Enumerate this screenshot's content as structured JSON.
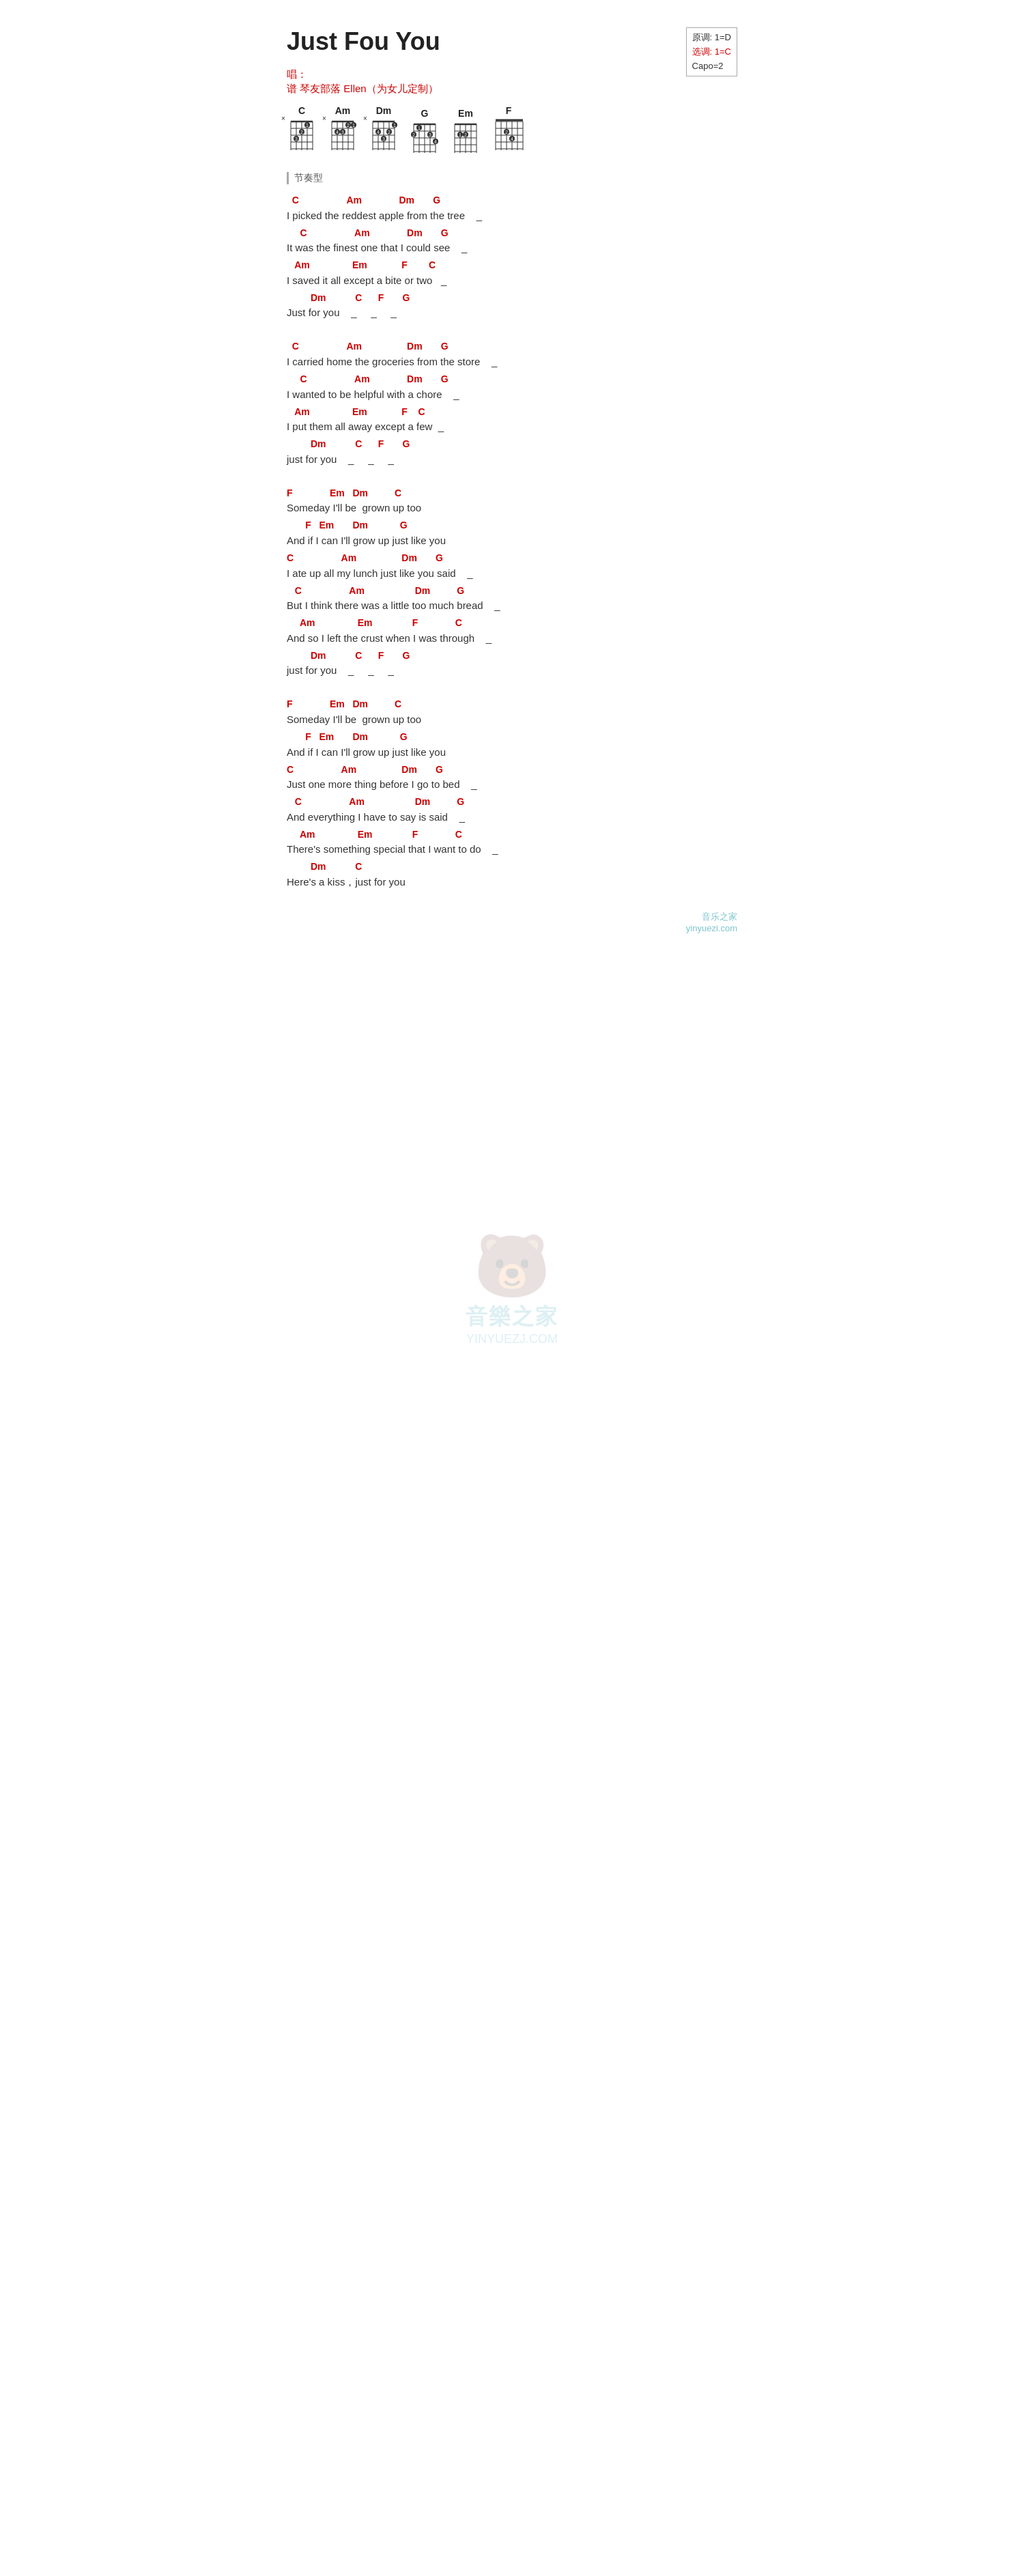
{
  "title": "Just Fou You",
  "singer_label": "唱：",
  "transcriber_label": "谱",
  "transcriber_name": "琴友部落 Ellen（为女儿定制）",
  "key_info": {
    "original": "原调: 1=D",
    "selected": "选调: 1=C",
    "capo": "Capo=2"
  },
  "chord_diagrams": [
    {
      "name": "C"
    },
    {
      "name": "Am"
    },
    {
      "name": "Dm"
    },
    {
      "name": "G"
    },
    {
      "name": "Em"
    },
    {
      "name": "F"
    }
  ],
  "section_label": "节奏型",
  "verses": [
    {
      "lines": [
        {
          "chord": "C                  Am              Dm       G",
          "lyric": "I picked the reddest apple from the tree    _"
        },
        {
          "chord": "   C                  Am              Dm       G",
          "lyric": "It was the finest one that I could see    _"
        },
        {
          "chord": "  Am                Em             F        C",
          "lyric": "I saved it all except a bite or two   _"
        },
        {
          "chord": "       Dm           C      F       G",
          "lyric": "Just for you    _     _     _"
        }
      ]
    },
    {
      "lines": [
        {
          "chord": "C                  Am                 Dm       G",
          "lyric": "I carried home the groceries from the store    _"
        },
        {
          "chord": "   C                  Am              Dm       G",
          "lyric": "I wanted to be helpful with a chore    _"
        },
        {
          "chord": "  Am                Em             F    C",
          "lyric": "I put them all away except a few  _"
        },
        {
          "chord": "       Dm           C      F       G",
          "lyric": "just for you    _     _     _"
        }
      ]
    },
    {
      "lines": [
        {
          "chord": "F              Em   Dm          C",
          "lyric": "Someday I'll be  grown up too"
        },
        {
          "chord": "       F   Em       Dm            G",
          "lyric": "And if I can I'll grow up just like you"
        },
        {
          "chord": "C                  Am                 Dm       G",
          "lyric": "I ate up all my lunch just like you said    _"
        },
        {
          "chord": "   C                  Am                   Dm          G",
          "lyric": "But I think there was a little too much bread    _"
        },
        {
          "chord": "     Am                Em               F              C",
          "lyric": "And so I left the crust when I was through    _"
        },
        {
          "chord": "         Dm           C      F       G",
          "lyric": "just for you    _     _     _"
        }
      ]
    },
    {
      "lines": [
        {
          "chord": "F              Em   Dm          C",
          "lyric": "Someday I'll be  grown up too"
        },
        {
          "chord": "       F   Em       Dm            G",
          "lyric": "And if I can I'll grow up just like you"
        },
        {
          "chord": "C                  Am                 Dm       G",
          "lyric": "Just one more thing before I go to bed    _"
        },
        {
          "chord": "   C                  Am                   Dm          G",
          "lyric": "And everything I have to say is said    _"
        },
        {
          "chord": "     Am                Em               F              C",
          "lyric": "There's something special that I want to do    _"
        },
        {
          "chord": "         Dm           C",
          "lyric": "Here's a kiss，just for you"
        }
      ]
    }
  ],
  "watermark": {
    "icon": "🐻",
    "text": "音樂之家",
    "url": "YINYUEZJ.COM"
  },
  "bottom_watermark": "音乐之家\nyinyuezi.com"
}
